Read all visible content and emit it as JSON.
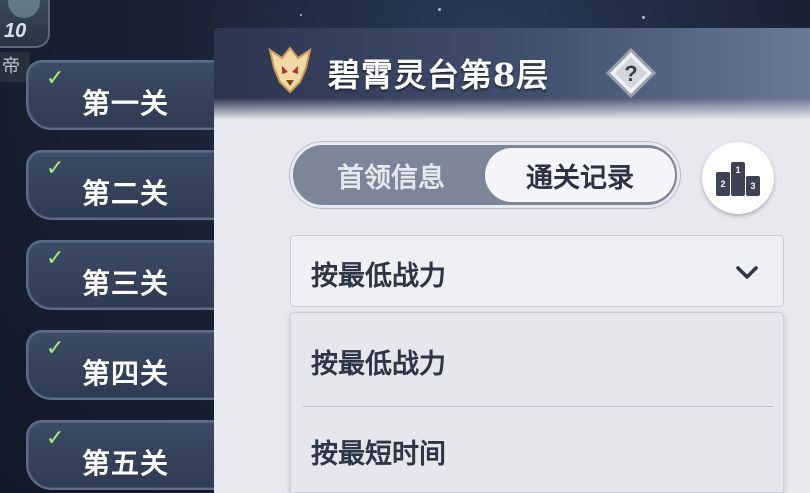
{
  "badge": {
    "level": "10",
    "partial_text": "帝"
  },
  "stages": [
    {
      "label": "第一关",
      "checked": true
    },
    {
      "label": "第二关",
      "checked": true
    },
    {
      "label": "第三关",
      "checked": true
    },
    {
      "label": "第四关",
      "checked": true
    },
    {
      "label": "第五关",
      "checked": true
    }
  ],
  "panel": {
    "title": "碧霄灵台第8层",
    "help_icon": "question-icon",
    "emblem_icon": "demon-mask-icon"
  },
  "tabs": [
    {
      "label": "首领信息",
      "active": false
    },
    {
      "label": "通关记录",
      "active": true
    }
  ],
  "rank_button": {
    "icon": "podium-icon"
  },
  "sort": {
    "selected": "按最低战力",
    "options": [
      "按最低战力",
      "按最短时间"
    ]
  },
  "colors": {
    "check": "#9ef07c",
    "panel_bg": "#e7e9ee",
    "stage_bg": "#36435e",
    "seg_bg": "#7d8598"
  }
}
